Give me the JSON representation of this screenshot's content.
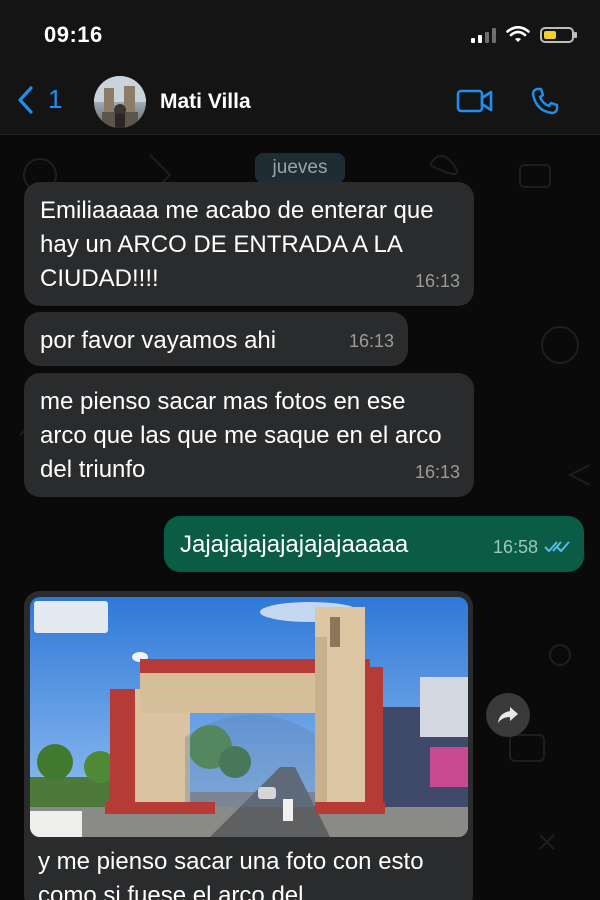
{
  "status": {
    "time": "09:16"
  },
  "header": {
    "back_count": "1",
    "contact_name": "Mati Villa"
  },
  "chat": {
    "date": "jueves",
    "messages": [
      {
        "text": "Emiliaaaaa me acabo de enterar que hay un ARCO DE ENTRADA A LA CIUDAD!!!!",
        "time": "16:13"
      },
      {
        "text": "por favor vayamos ahi",
        "time": "16:13"
      },
      {
        "text": "me pienso sacar mas fotos en ese arco que las que me saque en el arco del triunfo",
        "time": "16:13"
      },
      {
        "text": "Jajajajajajajajajaaaaa",
        "time": "16:58"
      }
    ],
    "image_caption": "y me pienso sacar una foto con esto como si fuese el arco del"
  },
  "colors": {
    "accent": "#1e8ff0",
    "incoming": "#2a2b2c",
    "outgoing": "#0b5c45"
  }
}
